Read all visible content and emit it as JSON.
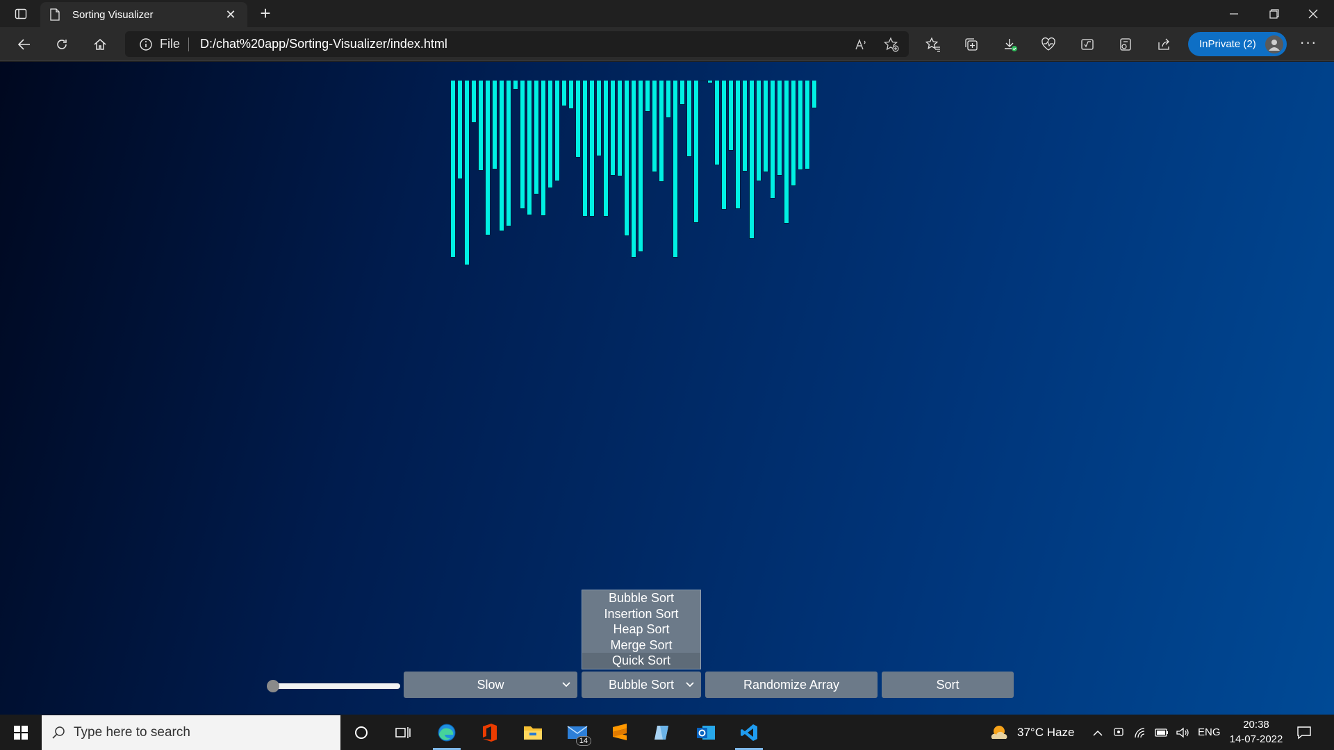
{
  "browser": {
    "tab_title": "Sorting Visualizer",
    "new_tab": "+",
    "address_scheme": "File",
    "address_url": "D:/chat%20app/Sorting-Visualizer/index.html",
    "profile_label": "InPrivate (2)"
  },
  "visualizer": {
    "bar_heights": [
      255,
      142,
      266,
      61,
      130,
      223,
      128,
      217,
      210,
      13,
      185,
      194,
      164,
      195,
      155,
      145,
      37,
      41,
      111,
      196,
      196,
      109,
      196,
      137,
      138,
      224,
      255,
      247,
      45,
      132,
      146,
      54,
      255,
      35,
      110,
      205,
      1,
      4,
      122,
      186,
      101,
      185,
      131,
      228,
      145,
      132,
      170,
      137,
      206,
      152,
      129,
      128,
      40
    ],
    "bar_color": "#00f0e4"
  },
  "controls": {
    "speed_label": "Slow",
    "speed_slider_value": 0,
    "algorithm_label": "Bubble Sort",
    "algorithm_options": [
      "Bubble Sort",
      "Insertion Sort",
      "Heap Sort",
      "Merge Sort",
      "Quick Sort"
    ],
    "highlighted_option_index": 4,
    "randomize_label": "Randomize Array",
    "sort_label": "Sort"
  },
  "taskbar": {
    "search_placeholder": "Type here to search",
    "mail_badge": "14",
    "weather": "37°C  Haze",
    "language": "ENG",
    "time": "20:38",
    "date": "14-07-2022"
  },
  "colors": {
    "accent": "#0e6fc5",
    "control_bg": "#6c7a89"
  }
}
